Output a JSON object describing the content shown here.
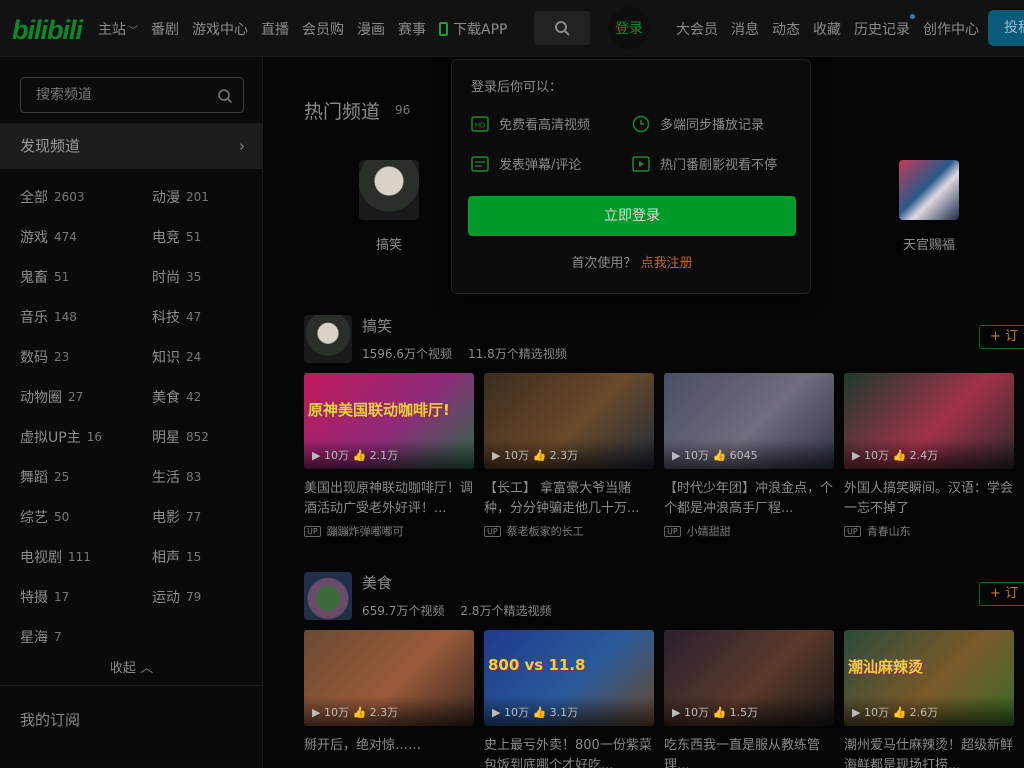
{
  "nav": {
    "logo": "bilibili",
    "left_items": [
      {
        "label": "主站",
        "has_chevron": true
      },
      {
        "label": "番剧"
      },
      {
        "label": "游戏中心"
      },
      {
        "label": "直播"
      },
      {
        "label": "会员购"
      },
      {
        "label": "漫画"
      },
      {
        "label": "赛事"
      },
      {
        "label": "下载APP",
        "icon": "phone-icon"
      }
    ],
    "login": "登录",
    "right_items": [
      "大会员",
      "消息",
      "动态",
      "收藏",
      "历史记录",
      "创作中心"
    ],
    "upload": "投稿"
  },
  "sidebar": {
    "search_placeholder": "搜索频道",
    "discover": "发现频道",
    "categories": [
      {
        "name": "全部",
        "count": "2603"
      },
      {
        "name": "动漫",
        "count": "201"
      },
      {
        "name": "游戏",
        "count": "474"
      },
      {
        "name": "电竞",
        "count": "51"
      },
      {
        "name": "鬼畜",
        "count": "51"
      },
      {
        "name": "时尚",
        "count": "35"
      },
      {
        "name": "音乐",
        "count": "148"
      },
      {
        "name": "科技",
        "count": "47"
      },
      {
        "name": "数码",
        "count": "23"
      },
      {
        "name": "知识",
        "count": "24"
      },
      {
        "name": "动物圈",
        "count": "27"
      },
      {
        "name": "美食",
        "count": "42"
      },
      {
        "name": "虚拟UP主",
        "count": "16"
      },
      {
        "name": "明星",
        "count": "852"
      },
      {
        "name": "舞蹈",
        "count": "25"
      },
      {
        "name": "生活",
        "count": "83"
      },
      {
        "name": "综艺",
        "count": "50"
      },
      {
        "name": "电影",
        "count": "77"
      },
      {
        "name": "电视剧",
        "count": "111"
      },
      {
        "name": "相声",
        "count": "15"
      },
      {
        "name": "特摄",
        "count": "17"
      },
      {
        "name": "运动",
        "count": "79"
      },
      {
        "name": "星海",
        "count": "7"
      }
    ],
    "collapse": "收起",
    "my_subscriptions": "我的订阅"
  },
  "hot": {
    "title": "热门频道",
    "count": "96",
    "items": [
      {
        "label": "搞笑"
      },
      {
        "label": "天官赐福"
      }
    ]
  },
  "sections": [
    {
      "name": "搞笑",
      "videos_stat": "1596.6万个视频",
      "featured_stat": "11.8万个精选视频",
      "subscribe": "+ 订",
      "videos": [
        {
          "title": "美国出现原神联动咖啡厅！调酒活动广受老外好评！...",
          "up": "蹦蹦炸弹嘟嘟可",
          "plays": "10万",
          "likes": "2.1万",
          "caption": "原神美国联动咖啡厅!",
          "colors": [
            "#c2185b",
            "#8e2a7a",
            "#2a6f4a"
          ]
        },
        {
          "title": "【长工】 拿富豪大爷当赌种，分分钟骗走他几十万...",
          "up": "蔡老板家的长工",
          "plays": "10万",
          "likes": "2.3万",
          "caption": "",
          "colors": [
            "#3c2c1e",
            "#6a4a2a",
            "#1f2a3a"
          ]
        },
        {
          "title": "【时代少年团】冲浪金点，个个都是冲浪高手厂程...",
          "up": "小婧甜甜",
          "plays": "10万",
          "likes": "6045",
          "caption": "",
          "colors": [
            "#4a4e66",
            "#706c7c",
            "#2d3346"
          ]
        },
        {
          "title": "外国人搞笑瞬间。汉语：学会一忘不掉了",
          "up": "青春山东",
          "plays": "10万",
          "likes": "2.4万",
          "caption": "",
          "colors": [
            "#1e3a2c",
            "#a0324a",
            "#2a2a2a"
          ]
        }
      ]
    },
    {
      "name": "美食",
      "videos_stat": "659.7万个视频",
      "featured_stat": "2.8万个精选视频",
      "subscribe": "+ 订",
      "videos": [
        {
          "title": "掰开后，绝对惊……",
          "up": "",
          "plays": "10万",
          "likes": "2.3万",
          "caption": "",
          "colors": [
            "#6a4a30",
            "#9a5a3a",
            "#3a2a22"
          ]
        },
        {
          "title": "史上最亏外卖！800一份紫菜包饭到底哪个才好吃...",
          "up": "",
          "plays": "10万",
          "likes": "3.1万",
          "caption": "800 vs 11.8",
          "colors": [
            "#1f3a8a",
            "#2a5a9a",
            "#6a4a2a"
          ]
        },
        {
          "title": "吃东西我一直是服从教练管理...",
          "up": "",
          "plays": "10万",
          "likes": "1.5万",
          "caption": "",
          "colors": [
            "#2a2030",
            "#5a3a2a",
            "#1a1a1a"
          ]
        },
        {
          "title": "潮州爱马仕麻辣烫！超级新鲜海鲜都是现场打捞...",
          "up": "",
          "plays": "10万",
          "likes": "2.6万",
          "caption": "潮汕麻辣烫",
          "colors": [
            "#2a4a3a",
            "#7a5a2a",
            "#3a6a2a"
          ]
        }
      ]
    }
  ],
  "popover": {
    "title": "登录后你可以：",
    "perks": [
      {
        "label": "免费看高清视频",
        "icon": "hd-icon"
      },
      {
        "label": "多端同步播放记录",
        "icon": "clock-icon"
      },
      {
        "label": "发表弹幕/评论",
        "icon": "comment-icon"
      },
      {
        "label": "热门番剧影视看不停",
        "icon": "play-icon"
      }
    ],
    "login_button": "立即登录",
    "register_prompt": "首次使用？",
    "register_link": "点我注册"
  },
  "colors": {
    "accent_green": "#009a29",
    "link_orange": "#c86a1a",
    "sidebar_active": "#1d1d1d"
  }
}
